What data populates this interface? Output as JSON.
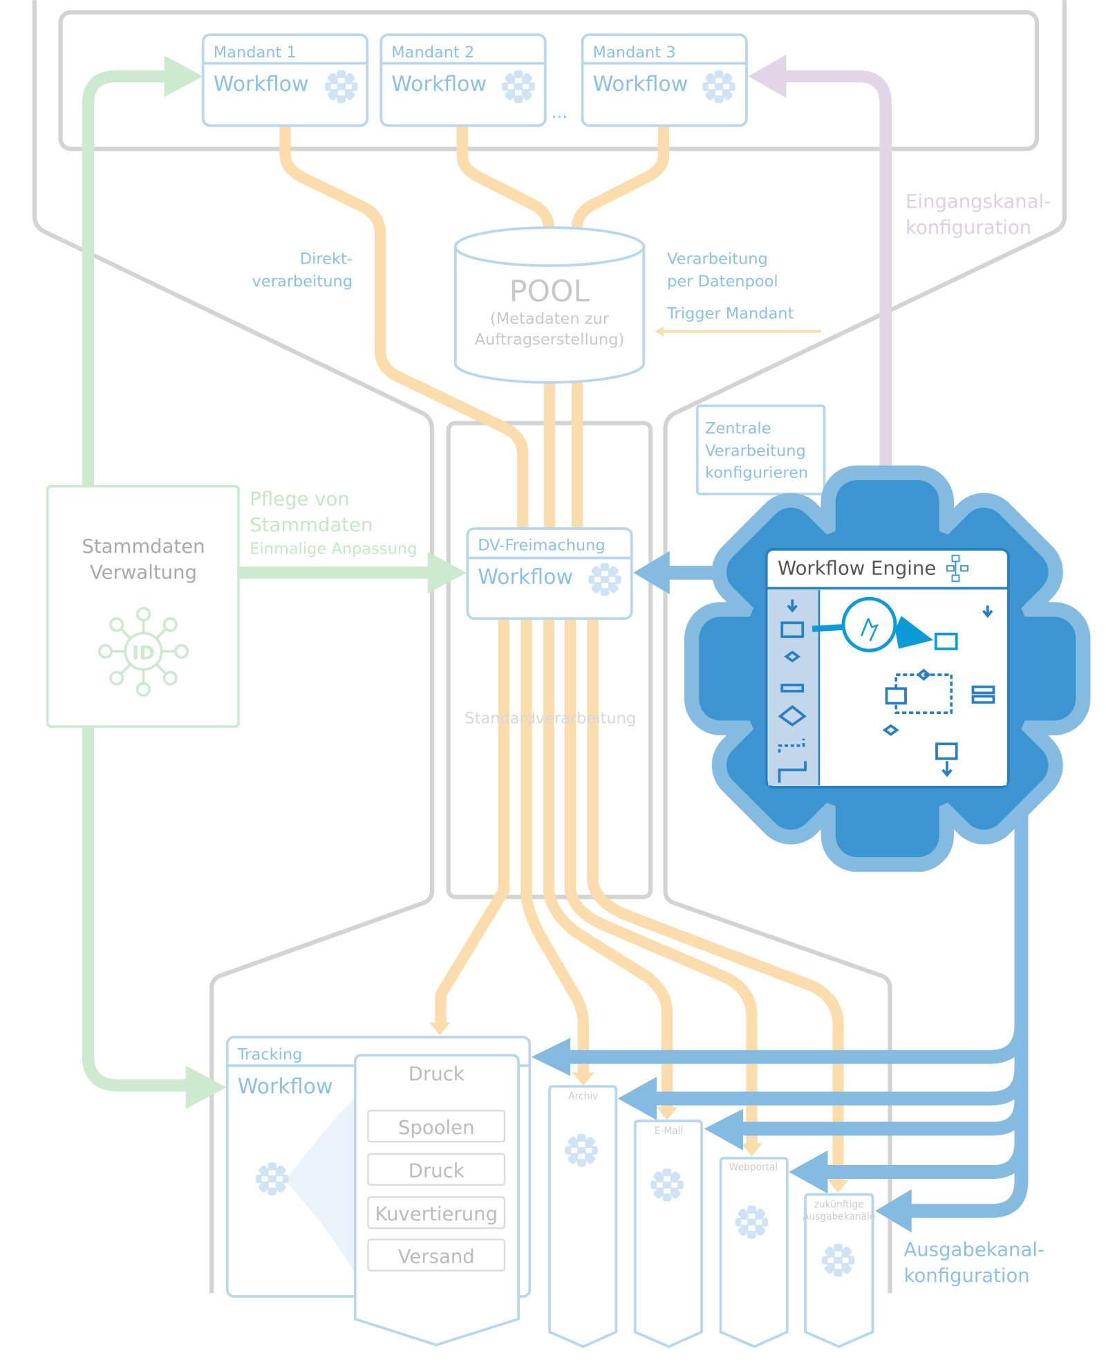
{
  "mandanten": [
    {
      "title": "Mandant 1",
      "label": "Workflow"
    },
    {
      "title": "Mandant 2",
      "label": "Workflow"
    },
    {
      "title": "Mandant 3",
      "label": "Workflow"
    }
  ],
  "ellipsis": "...",
  "labels": {
    "direkt_1": "Direkt-",
    "direkt_2": "verarbeitung",
    "pool_1": "Verarbeitung",
    "pool_2": "per Datenpool",
    "trigger": "Trigger Mandant",
    "eingang_1": "Eingangskanal-",
    "eingang_2": "konfiguration",
    "pflege_1": "Pflege von",
    "pflege_2": "Stammdaten",
    "pflege_3": "Einmalige Anpassung",
    "standard": "Standardverarbeitung",
    "ausgabe_1": "Ausgabekanal-",
    "ausgabe_2": "konfiguration"
  },
  "pool": {
    "title": "POOL",
    "sub_1": "(Metadaten zur",
    "sub_2": "Auftragserstellung)"
  },
  "stammdaten": {
    "line_1": "Stammdaten",
    "line_2": "Verwaltung",
    "badge": "ID"
  },
  "dv": {
    "title": "DV-Freimachung",
    "label": "Workflow"
  },
  "zentrale": {
    "line_1": "Zentrale",
    "line_2": "Verarbeitung",
    "line_3": "konfigurieren"
  },
  "engine": {
    "title": "Workflow Engine"
  },
  "tracking": {
    "title": "Tracking",
    "label": "Workflow"
  },
  "druck": {
    "title": "Druck",
    "steps": [
      "Spoolen",
      "Druck",
      "Kuvertierung",
      "Versand"
    ]
  },
  "channels": [
    {
      "title": "Archiv"
    },
    {
      "title": "E-Mail"
    },
    {
      "title": "Webportal"
    },
    {
      "title_1": "zukünftige",
      "title_2": "Ausgabekanäle"
    }
  ],
  "colors": {
    "orange": "#fbdcad",
    "green": "#cde9cf",
    "purple": "#e2d5e8",
    "blue": "#85bbe0",
    "gear": "#3c94d0"
  }
}
